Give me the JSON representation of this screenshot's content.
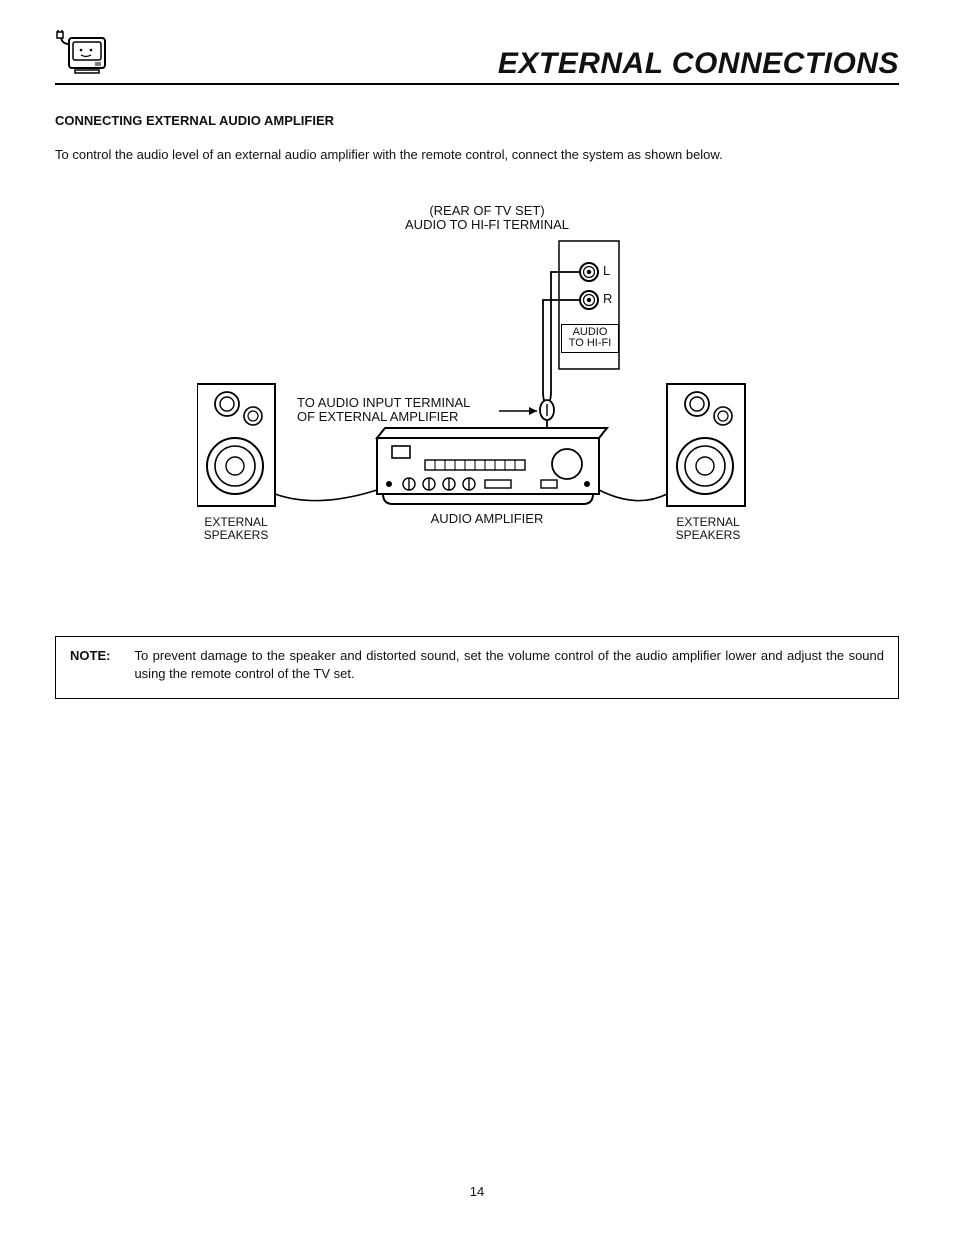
{
  "header": {
    "title": "EXTERNAL CONNECTIONS"
  },
  "section": {
    "heading": "CONNECTING EXTERNAL AUDIO AMPLIFIER",
    "body": "To control the audio level of an external audio amplifier with the remote control, connect the system as shown below."
  },
  "diagram": {
    "rear_line1": "(REAR OF TV SET)",
    "rear_line2": "AUDIO TO HI-FI TERMINAL",
    "jack_L": "L",
    "jack_R": "R",
    "port_line1": "AUDIO",
    "port_line2": "TO HI-FI",
    "callout_line1": "TO AUDIO INPUT TERMINAL",
    "callout_line2": "OF EXTERNAL AMPLIFIER",
    "amp_label": "AUDIO AMPLIFIER",
    "spk_left_line1": "EXTERNAL",
    "spk_left_line2": "SPEAKERS",
    "spk_right_line1": "EXTERNAL",
    "spk_right_line2": "SPEAKERS"
  },
  "note": {
    "label": "NOTE:",
    "text": "To prevent damage to the speaker and distorted sound, set the volume control of the audio amplifier lower and adjust the sound using the remote control of the TV set."
  },
  "page_number": "14"
}
